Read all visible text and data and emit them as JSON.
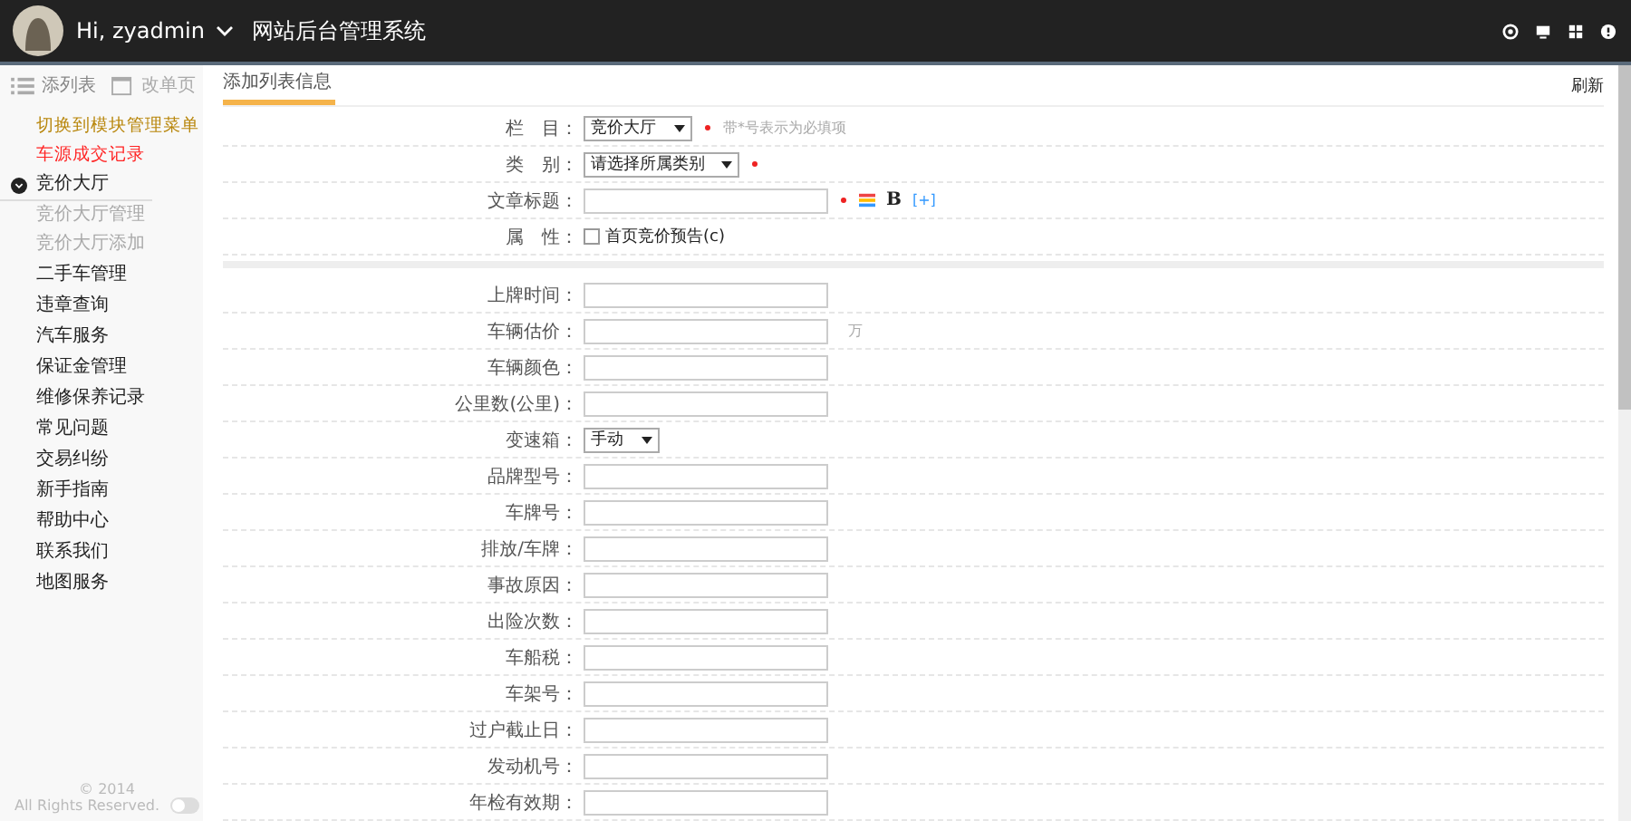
{
  "header": {
    "user": "Hi, zyadmin",
    "title": "网站后台管理系统"
  },
  "sidebar": {
    "tabs": [
      {
        "label": "添列表",
        "selected": true
      },
      {
        "label": "改单页",
        "selected": false
      }
    ],
    "items": [
      {
        "kind": "highlight",
        "label": "切换到模块管理菜单",
        "color": "#b8860b"
      },
      {
        "kind": "highlight",
        "label": "车源成交记录",
        "color": "#ff2222"
      },
      {
        "kind": "section",
        "label": "竞价大厅",
        "expanded": true,
        "children": [
          {
            "label": "竞价大厅管理"
          },
          {
            "label": "竞价大厅添加"
          }
        ]
      },
      {
        "kind": "item",
        "label": "二手车管理"
      },
      {
        "kind": "item",
        "label": "违章查询"
      },
      {
        "kind": "item",
        "label": "汽车服务"
      },
      {
        "kind": "item",
        "label": "保证金管理"
      },
      {
        "kind": "item",
        "label": "维修保养记录"
      },
      {
        "kind": "item",
        "label": "常见问题"
      },
      {
        "kind": "item",
        "label": "交易纠纷"
      },
      {
        "kind": "item",
        "label": "新手指南"
      },
      {
        "kind": "item",
        "label": "帮助中心"
      },
      {
        "kind": "item",
        "label": "联系我们"
      },
      {
        "kind": "item",
        "label": "地图服务"
      }
    ],
    "footer": {
      "copyright": "© 2014",
      "rights": "All Rights Reserved.",
      "toggle_on": false
    }
  },
  "content": {
    "tab": "添加列表信息",
    "refresh": "刷新",
    "top_fields": [
      {
        "kind": "select",
        "label": "栏　目：",
        "value": "竞价大厅",
        "required": true,
        "hint": "带*号表示为必填项"
      },
      {
        "kind": "select",
        "label": "类　别：",
        "value": "请选择所属类别",
        "required": true
      },
      {
        "kind": "title",
        "label": "文章标题：",
        "required": true,
        "bold": "B",
        "more": "[+]"
      },
      {
        "kind": "checkbox",
        "label": "属　性：",
        "option": "首页竞价预告(c)",
        "checked": false
      }
    ],
    "fields": [
      {
        "kind": "text",
        "label": "上牌时间："
      },
      {
        "kind": "text",
        "label": "车辆估价：",
        "unit": "万"
      },
      {
        "kind": "text",
        "label": "车辆颜色："
      },
      {
        "kind": "text",
        "label": "公里数(公里)："
      },
      {
        "kind": "select",
        "label": "变速箱：",
        "value": "手动"
      },
      {
        "kind": "text",
        "label": "品牌型号："
      },
      {
        "kind": "text",
        "label": "车牌号："
      },
      {
        "kind": "text",
        "label": "排放/车牌："
      },
      {
        "kind": "text",
        "label": "事故原因："
      },
      {
        "kind": "text",
        "label": "出险次数："
      },
      {
        "kind": "text",
        "label": "车船税："
      },
      {
        "kind": "text",
        "label": "车架号："
      },
      {
        "kind": "text",
        "label": "过户截止日："
      },
      {
        "kind": "text",
        "label": "发动机号："
      },
      {
        "kind": "text",
        "label": "年检有效期："
      }
    ]
  }
}
